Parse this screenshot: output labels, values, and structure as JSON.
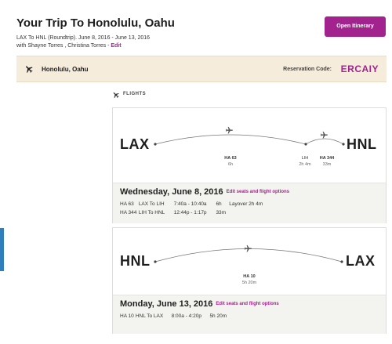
{
  "header": {
    "title": "Your Trip To Honolulu, Oahu",
    "route_line": "LAX To HNL (Roundtrip). June 8, 2016 - June 13, 2016",
    "travelers_line": "with Shayne Torres , Christina Torres - ",
    "edit_label": "Edit",
    "open_itinerary_label": "Open Itinerary"
  },
  "destination": {
    "name": "Honolulu, Oahu",
    "reservation_label": "Reservation Code:",
    "reservation_code": "ERCAIY"
  },
  "flights_heading": "FLIGHTS",
  "outbound": {
    "from": "LAX",
    "to": "HNL",
    "stop": "LIH",
    "leg1_flight": "HA 63",
    "leg1_duration": "6h",
    "layover_short": "2h 4m",
    "leg2_flight": "HA 344",
    "leg2_duration": "33m",
    "day_title": "Wednesday, June 8, 2016",
    "edit_seats_label": "Edit seats and flight options",
    "segments": [
      {
        "flight": "HA 63",
        "route": "LAX To LIH",
        "times": "7:40a - 10:40a",
        "duration": "6h",
        "extra": "Layover 2h 4m"
      },
      {
        "flight": "HA 344",
        "route": "LIH To HNL",
        "times": "12:44p - 1:17p",
        "duration": "33m",
        "extra": ""
      }
    ]
  },
  "return": {
    "from": "HNL",
    "to": "LAX",
    "flight": "HA 10",
    "duration": "5h 20m",
    "day_title": "Monday, June 13, 2016",
    "edit_seats_label": "Edit seats and flight options",
    "segments": [
      {
        "flight": "HA 10",
        "route": "HNL To LAX",
        "times": "8:00a - 4:20p",
        "duration": "5h 20m"
      }
    ]
  },
  "colors": {
    "accent": "#a3238e",
    "banner": "#f6ecdb",
    "details_bg": "#f3f3ef",
    "side_tab": "#2f7fbf"
  },
  "icons": [
    "airplane-icon"
  ]
}
